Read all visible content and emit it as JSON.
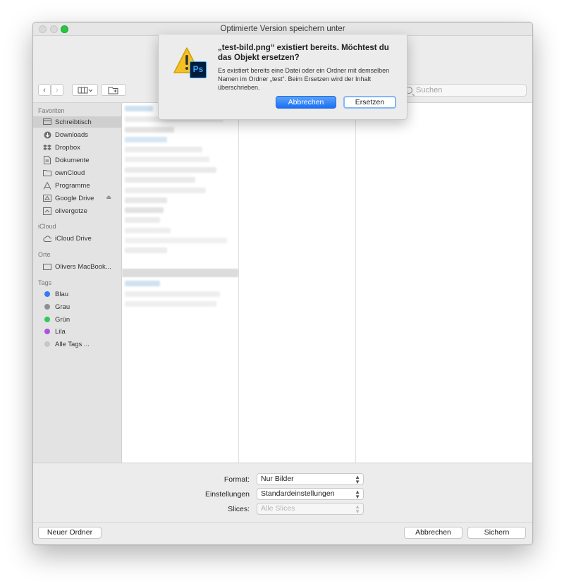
{
  "window": {
    "title": "Optimierte Version speichern unter"
  },
  "search": {
    "placeholder": "Suchen"
  },
  "sidebar": {
    "sections": [
      {
        "label": "Favoriten"
      },
      {
        "label": "iCloud"
      },
      {
        "label": "Orte"
      },
      {
        "label": "Tags"
      }
    ],
    "favorites": [
      {
        "label": "Schreibtisch",
        "icon": "desktop-icon"
      },
      {
        "label": "Downloads",
        "icon": "download-icon"
      },
      {
        "label": "Dropbox",
        "icon": "dropbox-icon"
      },
      {
        "label": "Dokumente",
        "icon": "document-icon"
      },
      {
        "label": "ownCloud",
        "icon": "folder-icon"
      },
      {
        "label": "Programme",
        "icon": "applications-icon"
      },
      {
        "label": "Google Drive",
        "icon": "drive-icon"
      },
      {
        "label": "olivergotze",
        "icon": "home-icon"
      }
    ],
    "icloud": [
      {
        "label": "iCloud Drive",
        "icon": "cloud-icon"
      }
    ],
    "places": [
      {
        "label": "Olivers MacBook...",
        "icon": "laptop-icon"
      }
    ],
    "tags": [
      {
        "label": "Blau",
        "color": "#3478f6"
      },
      {
        "label": "Grau",
        "color": "#8e8e93"
      },
      {
        "label": "Grün",
        "color": "#34c759"
      },
      {
        "label": "Lila",
        "color": "#af52de"
      },
      {
        "label": "Alle Tags ...",
        "color": "#c7c7c7"
      }
    ]
  },
  "form": {
    "format_label": "Format:",
    "format_value": "Nur Bilder",
    "settings_label": "Einstellungen",
    "settings_value": "Standardeinstellungen",
    "slices_label": "Slices:",
    "slices_value": "Alle Slices"
  },
  "buttons": {
    "new_folder": "Neuer Ordner",
    "cancel": "Abbrechen",
    "save": "Sichern"
  },
  "alert": {
    "title": "„test-bild.png“ existiert bereits. Möchtest du das Objekt ersetzen?",
    "message": "Es existiert bereits eine Datei oder ein Ordner mit demselben Namen im Ordner „test“. Beim Ersetzen wird der Inhalt überschrieben.",
    "cancel": "Abbrechen",
    "replace": "Ersetzen",
    "app_badge": "Ps",
    "accent_color": "#1a6ff4"
  }
}
